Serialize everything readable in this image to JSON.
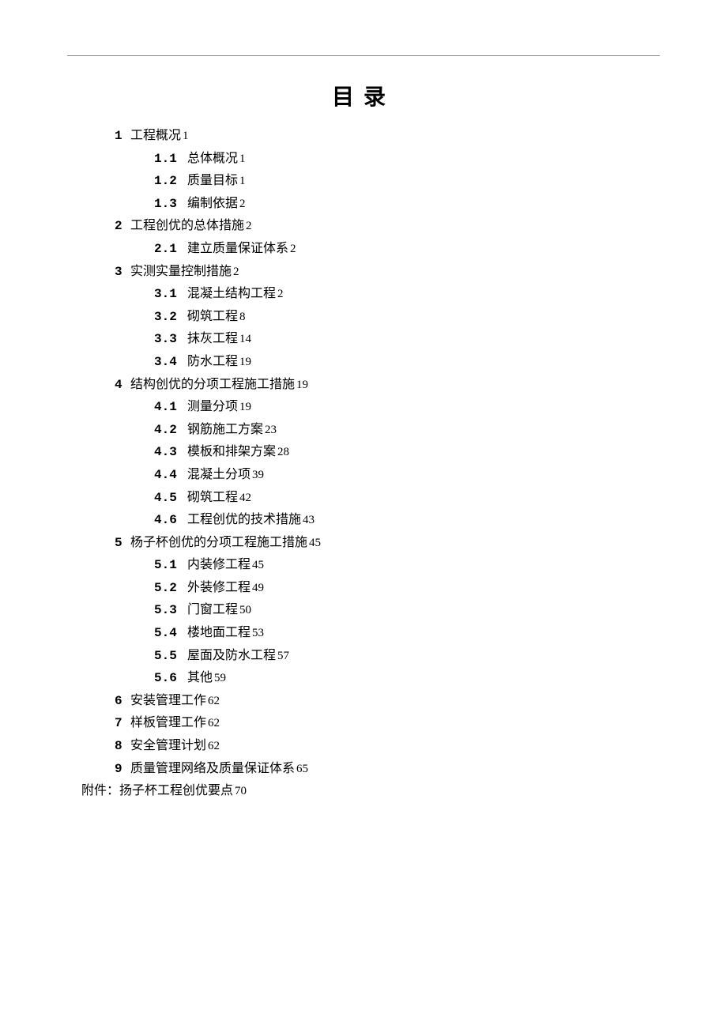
{
  "title": "目录",
  "toc": [
    {
      "level": 1,
      "num": "1",
      "text": "工程概况",
      "page": "1"
    },
    {
      "level": 2,
      "num": "1.1",
      "text": "总体概况",
      "page": "1"
    },
    {
      "level": 2,
      "num": "1.2",
      "text": "质量目标",
      "page": "1"
    },
    {
      "level": 2,
      "num": "1.3",
      "text": "编制依据",
      "page": "2"
    },
    {
      "level": 1,
      "num": "2",
      "text": "工程创优的总体措施",
      "page": "2"
    },
    {
      "level": 2,
      "num": "2.1",
      "text": "建立质量保证体系",
      "page": "2"
    },
    {
      "level": 1,
      "num": "3",
      "text": "实测实量控制措施",
      "page": "2"
    },
    {
      "level": 2,
      "num": "3.1",
      "text": "混凝土结构工程",
      "page": "2"
    },
    {
      "level": 2,
      "num": "3.2",
      "text": "砌筑工程",
      "page": "8"
    },
    {
      "level": 2,
      "num": "3.3",
      "text": "抹灰工程",
      "page": "14"
    },
    {
      "level": 2,
      "num": "3.4",
      "text": "防水工程",
      "page": "19"
    },
    {
      "level": 1,
      "num": "4",
      "text": "结构创优的分项工程施工措施",
      "page": "19"
    },
    {
      "level": 2,
      "num": "4.1",
      "text": "测量分项",
      "page": "19"
    },
    {
      "level": 2,
      "num": "4.2",
      "text": "钢筋施工方案",
      "page": "23"
    },
    {
      "level": 2,
      "num": "4.3",
      "text": "模板和排架方案",
      "page": "28"
    },
    {
      "level": 2,
      "num": "4.4",
      "text": "混凝土分项",
      "page": "39"
    },
    {
      "level": 2,
      "num": "4.5",
      "text": "砌筑工程",
      "page": "42"
    },
    {
      "level": 2,
      "num": "4.6",
      "text": "工程创优的技术措施",
      "page": "43"
    },
    {
      "level": 1,
      "num": "5",
      "text": "杨子杯创优的分项工程施工措施",
      "page": "45"
    },
    {
      "level": 2,
      "num": "5.1",
      "text": "内装修工程",
      "page": "45"
    },
    {
      "level": 2,
      "num": "5.2",
      "text": "外装修工程",
      "page": "49"
    },
    {
      "level": 2,
      "num": "5.3",
      "text": "门窗工程",
      "page": "50"
    },
    {
      "level": 2,
      "num": "5.4",
      "text": "楼地面工程",
      "page": "53"
    },
    {
      "level": 2,
      "num": "5.5",
      "text": "屋面及防水工程",
      "page": "57"
    },
    {
      "level": 2,
      "num": "5.6",
      "text": "其他",
      "page": "59"
    },
    {
      "level": 1,
      "num": "6",
      "text": "安装管理工作",
      "page": "62"
    },
    {
      "level": 1,
      "num": "7",
      "text": "样板管理工作",
      "page": "62"
    },
    {
      "level": 1,
      "num": "8",
      "text": "安全管理计划",
      "page": "62"
    },
    {
      "level": 1,
      "num": "9",
      "text": "质量管理网络及质量保证体系",
      "page": "65"
    }
  ],
  "appendix": {
    "label": "附件：",
    "text": "扬子杯工程创优要点",
    "page": "70"
  }
}
